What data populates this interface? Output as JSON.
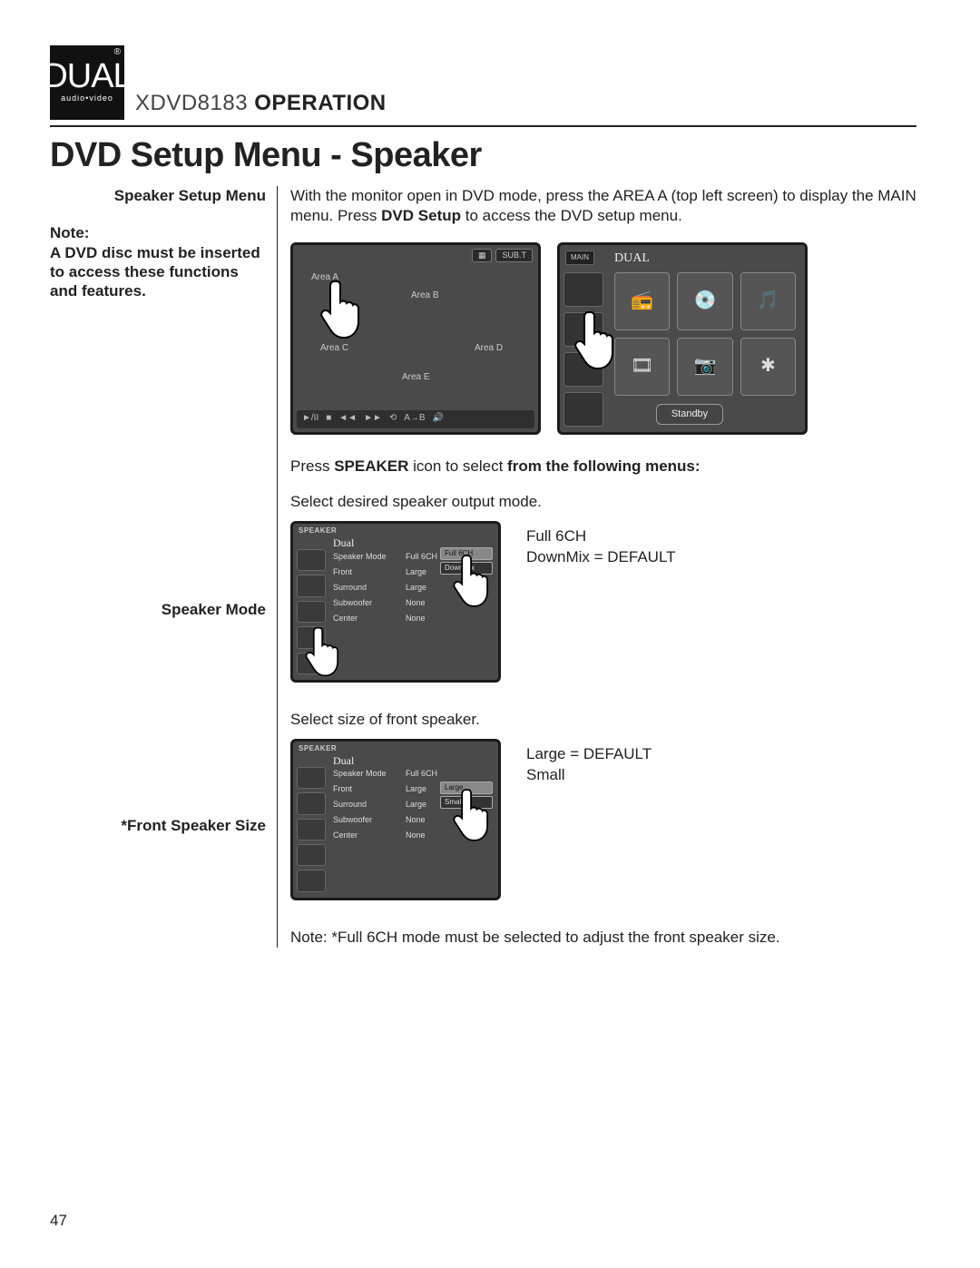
{
  "logo": {
    "brand": "DUAL",
    "sub": "audio•video",
    "reg": "®"
  },
  "header": {
    "model": "XDVD8183",
    "operation": " OPERATION"
  },
  "page_title": "DVD Setup Menu - Speaker",
  "left": {
    "speaker_setup_label": "Speaker Setup Menu",
    "note_label": "Note:",
    "note_text": "A DVD disc must be inserted to access these functions and features.",
    "speaker_mode_label": "Speaker Mode",
    "front_size_label": "*Front Speaker Size"
  },
  "right": {
    "intro_1": "With the monitor open in DVD mode, press the AREA A (top left screen) to display the MAIN menu. Press ",
    "intro_bold": "DVD Setup",
    "intro_2": " to access the DVD setup menu.",
    "press_1": "Press ",
    "press_bold1": "SPEAKER",
    "press_mid": " icon to select ",
    "press_bold2": "from the following menus:",
    "mode_desc": "Select desired speaker output mode.",
    "mode_vals": [
      "Full 6CH",
      "DownMix = DEFAULT"
    ],
    "front_desc": "Select size of front speaker.",
    "front_vals": [
      "Large = DEFAULT",
      "Small"
    ],
    "foot_note": "Note: *Full 6CH mode must be selected to adjust the front speaker size."
  },
  "screen1": {
    "sub_t": "SUB.T",
    "areas": {
      "a": "Area A",
      "b": "Area B",
      "c": "Area C",
      "d": "Area D",
      "e": "Area E"
    },
    "controls": [
      "►/II",
      "■",
      "◄◄",
      "►►",
      "⟲",
      "A→B",
      "🔊"
    ]
  },
  "screen2": {
    "main_tag1": "MAIN",
    "main_tag2": "MAIN",
    "standby": "Standby",
    "icons": [
      "📻",
      "💿",
      "🎵",
      "🎞",
      "📷",
      "✱"
    ]
  },
  "speaker_screen": {
    "title": "SPEAKER",
    "logo": "Dual",
    "rows": [
      {
        "c1": "Speaker Mode",
        "c2": "Full 6CH"
      },
      {
        "c1": "Front",
        "c2": "Large"
      },
      {
        "c1": "Surround",
        "c2": "Large"
      },
      {
        "c1": "Subwoofer",
        "c2": "None"
      },
      {
        "c1": "Center",
        "c2": "None"
      }
    ],
    "mode_opts": [
      "Full 6CH",
      "DownMix"
    ],
    "front_opts": [
      "Large",
      "Small"
    ]
  },
  "page_number": "47"
}
